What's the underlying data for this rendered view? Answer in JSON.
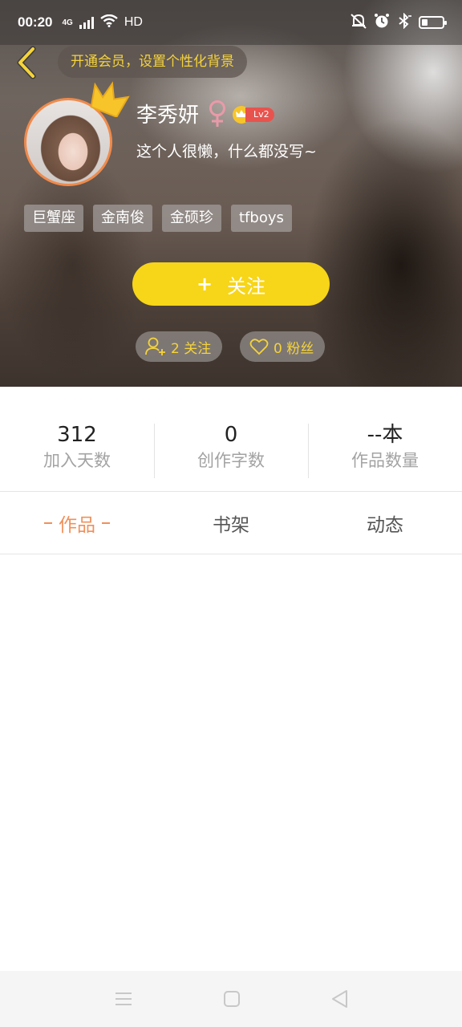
{
  "status_bar": {
    "time": "00:20",
    "network": "4G",
    "hd": "HD",
    "icons": [
      "signal-icon",
      "wifi-icon",
      "mute-icon",
      "alarm-icon",
      "bluetooth-icon",
      "battery-icon"
    ]
  },
  "header": {
    "back_icon": "chevron-left-icon",
    "vip_banner": "开通会员，设置个性化背景"
  },
  "profile": {
    "name": "李秀妍",
    "gender_symbol": "♀",
    "level": "Lv2",
    "bio": "这个人很懒，什么都没写~",
    "tags": [
      "巨蟹座",
      "金南俊",
      "金硕珍",
      "tfboys"
    ]
  },
  "follow_button": {
    "plus": "+",
    "label": "关注"
  },
  "social": {
    "following": "2 关注",
    "fans": "0 粉丝"
  },
  "stats": [
    {
      "value": "312",
      "label": "加入天数"
    },
    {
      "value": "0",
      "label": "创作字数"
    },
    {
      "value": "--本",
      "label": "作品数量"
    }
  ],
  "tabs": [
    {
      "label": "作品",
      "active": true
    },
    {
      "label": "书架",
      "active": false
    },
    {
      "label": "动态",
      "active": false
    }
  ],
  "colors": {
    "accent_yellow": "#f7d518",
    "banner_text": "#f5d33a",
    "active_tab": "#f0905a",
    "level_badge": "#e8534e",
    "gender": "#e99aa9",
    "avatar_border": "#f08a4b"
  },
  "nav_bar": {
    "icons": [
      "menu-icon",
      "home-icon",
      "back-triangle-icon"
    ]
  }
}
